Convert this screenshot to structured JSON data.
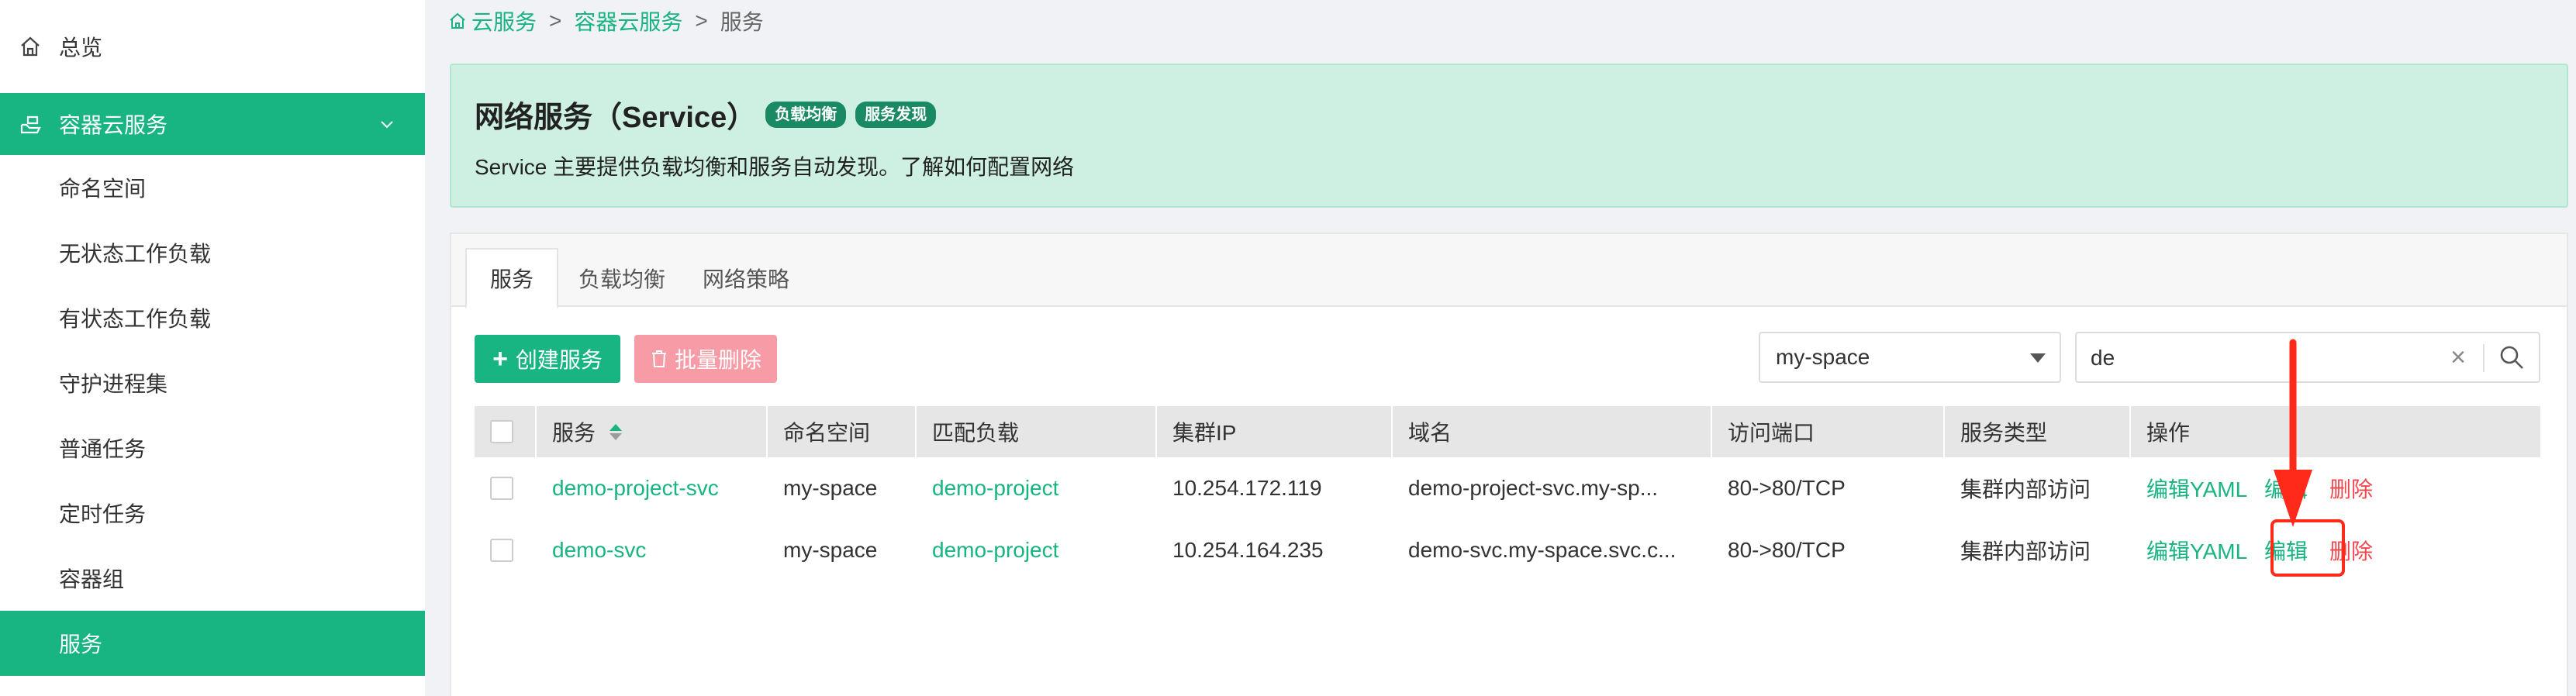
{
  "sidebar": {
    "overview": "总览",
    "group": "容器云服务",
    "items": [
      {
        "label": "命名空间"
      },
      {
        "label": "无状态工作负载"
      },
      {
        "label": "有状态工作负载"
      },
      {
        "label": "守护进程集"
      },
      {
        "label": "普通任务"
      },
      {
        "label": "定时任务"
      },
      {
        "label": "容器组"
      },
      {
        "label": "服务",
        "active": true
      }
    ]
  },
  "breadcrumb": {
    "items": [
      "云服务",
      "容器云服务",
      "服务"
    ],
    "separator": ">"
  },
  "banner": {
    "title": "网络服务（Service）",
    "tags": [
      "负载均衡",
      "服务发现"
    ],
    "description": "Service 主要提供负载均衡和服务自动发现。了解如何配置网络"
  },
  "tabs": [
    {
      "label": "服务",
      "active": true
    },
    {
      "label": "负载均衡"
    },
    {
      "label": "网络策略"
    }
  ],
  "toolbar": {
    "create_label": "创建服务",
    "batch_delete_label": "批量删除",
    "namespace_select": "my-space",
    "search_value": "de"
  },
  "table": {
    "columns": [
      "服务",
      "命名空间",
      "匹配负载",
      "集群IP",
      "域名",
      "访问端口",
      "服务类型",
      "操作"
    ],
    "rows": [
      {
        "name": "demo-project-svc",
        "namespace": "my-space",
        "workload": "demo-project",
        "cluster_ip": "10.254.172.119",
        "domain": "demo-project-svc.my-sp...",
        "port": "80->80/TCP",
        "type": "集群内部访问",
        "actions": {
          "yaml": "编辑YAML",
          "edit": "编辑",
          "delete": "删除"
        }
      },
      {
        "name": "demo-svc",
        "namespace": "my-space",
        "workload": "demo-project",
        "cluster_ip": "10.254.164.235",
        "domain": "demo-svc.my-space.svc.c...",
        "port": "80->80/TCP",
        "type": "集群内部访问",
        "actions": {
          "yaml": "编辑YAML",
          "edit": "编辑",
          "delete": "删除"
        }
      }
    ]
  },
  "colors": {
    "accent": "#18b481",
    "danger": "#f0484d",
    "annotation": "#ff2a1a"
  }
}
